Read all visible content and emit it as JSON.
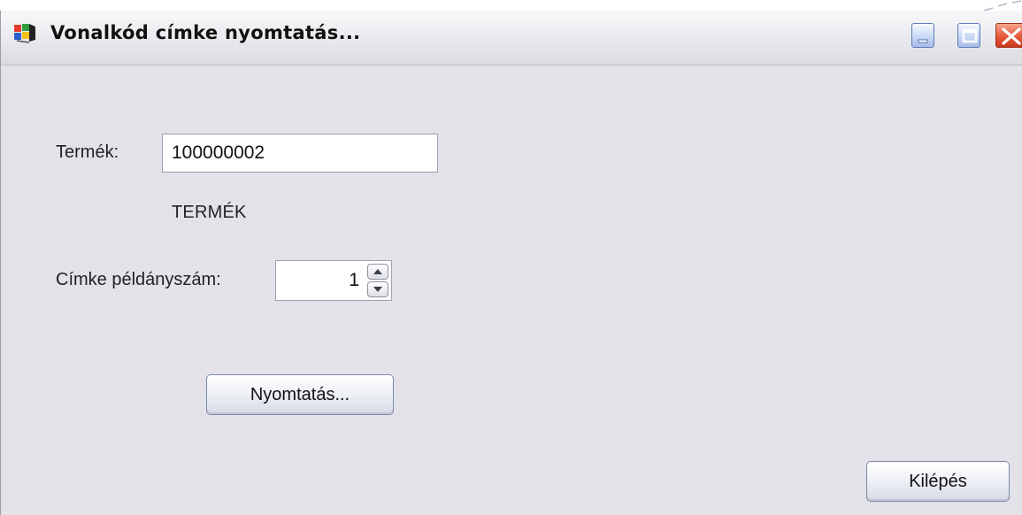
{
  "window": {
    "title": "Vonalkód címke nyomtatás...",
    "controls": {
      "minimize": "minimize-icon",
      "maximize": "maximize-icon",
      "close": "close-icon"
    }
  },
  "form": {
    "product_label": "Termék:",
    "product_value": "100000002",
    "product_name": "TERMÉK",
    "copies_label": "Címke példányszám:",
    "copies_value": "1"
  },
  "buttons": {
    "print_label": "Nyomtatás...",
    "exit_label": "Kilépés"
  },
  "colors": {
    "window_background": "#e3e2e8",
    "close_button": "#e4593a",
    "title_buttons": "#c9d8f5"
  }
}
